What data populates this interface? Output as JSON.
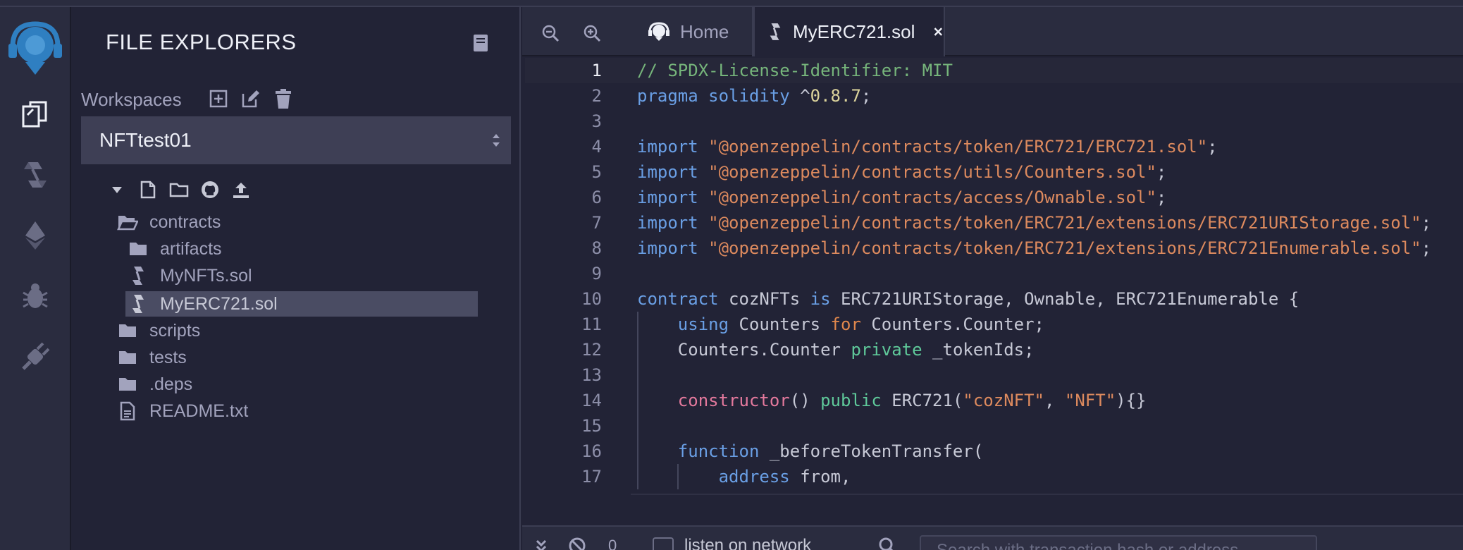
{
  "panel": {
    "title": "FILE EXPLORERS",
    "workspaces_label": "Workspaces",
    "workspace_selected": "NFTtest01"
  },
  "tree": [
    {
      "name": "contracts",
      "icon": "folder-open-icon"
    },
    {
      "name": "artifacts",
      "icon": "folder-icon"
    },
    {
      "name": "MyNFTs.sol",
      "icon": "solidity-file-icon"
    },
    {
      "name": "MyERC721.sol",
      "icon": "solidity-file-icon",
      "selected": true
    },
    {
      "name": "scripts",
      "icon": "folder-icon"
    },
    {
      "name": "tests",
      "icon": "folder-icon"
    },
    {
      "name": ".deps",
      "icon": "folder-icon"
    },
    {
      "name": "README.txt",
      "icon": "file-icon"
    }
  ],
  "tabs": {
    "home": "Home",
    "file": "MyERC721.sol"
  },
  "editor": {
    "line_numbers": [
      "1",
      "2",
      "3",
      "4",
      "5",
      "6",
      "7",
      "8",
      "9",
      "10",
      "11",
      "12",
      "13",
      "14",
      "15",
      "16",
      "17"
    ]
  },
  "terminal": {
    "count": "0",
    "listen_label": "listen on network",
    "search_placeholder": "Search with transaction hash or address"
  },
  "colors": {
    "background": "#222336",
    "panel": "#2a2c3f",
    "accent": "#2f7fc1",
    "selected_row": "#4a4c63"
  }
}
